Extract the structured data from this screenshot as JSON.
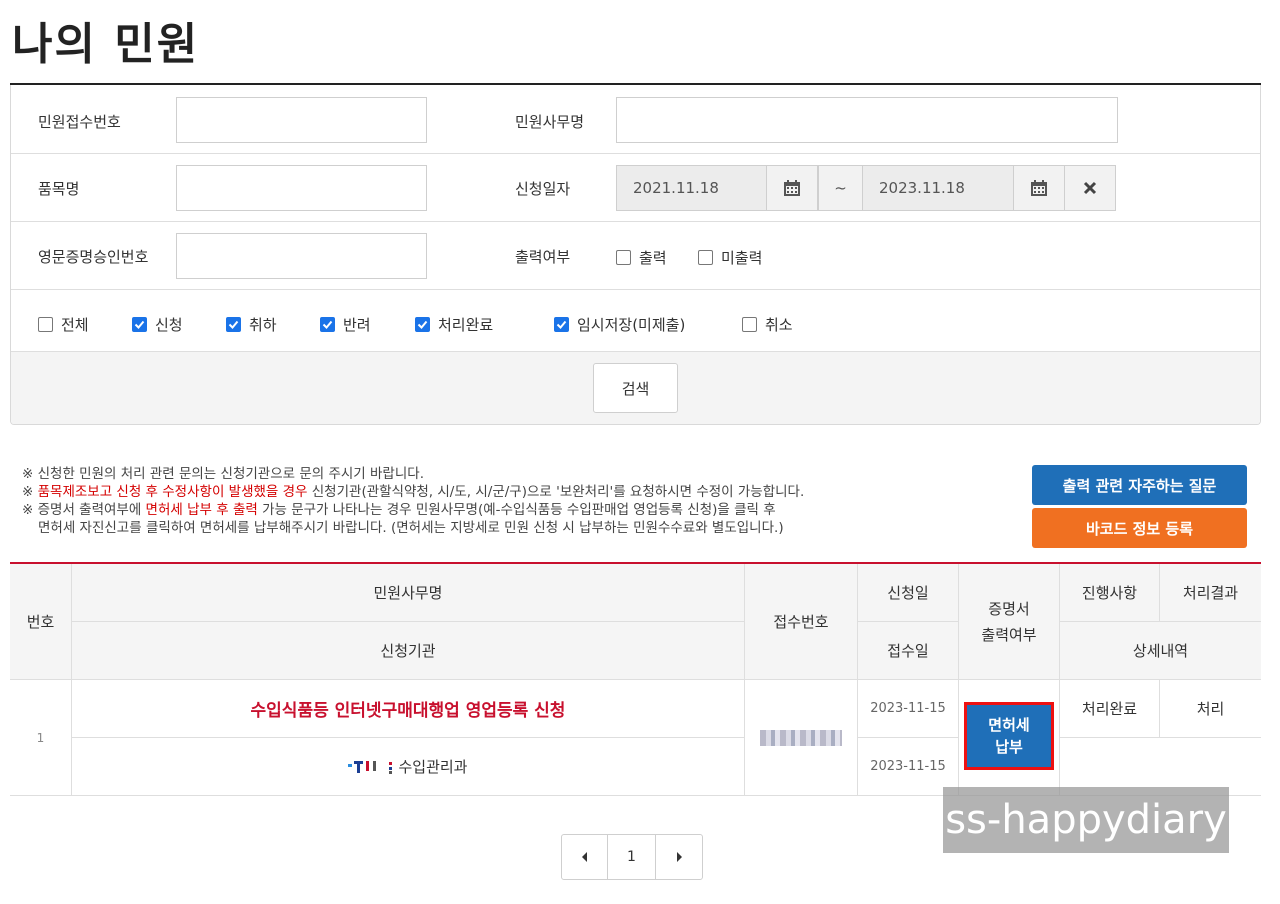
{
  "page": {
    "title": "나의 민원"
  },
  "search": {
    "receipt_no_label": "민원접수번호",
    "receipt_no_value": "",
    "task_name_label": "민원사무명",
    "task_name_value": "",
    "item_name_label": "품목명",
    "item_name_value": "",
    "apply_date_label": "신청일자",
    "date_from": "2021.11.18",
    "date_sep": "~",
    "date_to": "2023.11.18",
    "cert_no_label": "영문증명승인번호",
    "cert_no_value": "",
    "print_label": "출력여부",
    "print_options": [
      {
        "label": "출력",
        "checked": false
      },
      {
        "label": "미출력",
        "checked": false
      }
    ],
    "status_options": [
      {
        "label": "전체",
        "checked": false
      },
      {
        "label": "신청",
        "checked": true
      },
      {
        "label": "취하",
        "checked": true
      },
      {
        "label": "반려",
        "checked": true
      },
      {
        "label": "처리완료",
        "checked": true
      },
      {
        "label": "임시저장(미제출)",
        "checked": true
      },
      {
        "label": "취소",
        "checked": false
      }
    ],
    "search_button": "검색"
  },
  "notice": {
    "line1": "※ 신청한 민원의 처리 관련 문의는 신청기관으로 문의 주시기 바랍니다.",
    "line2_prefix": "※ ",
    "line2_red": "품목제조보고 신청 후 수정사항이 발생했을 경우",
    "line2_rest": " 신청기관(관할식약청, 시/도, 시/군/구)으로 '보완처리'를 요청하시면 수정이 가능합니다.",
    "line3_prefix": "※ 증명서 출력여부에 ",
    "line3_red": "면허세 납부 후 출력",
    "line3_rest": " 가능 문구가 나타나는 경우 민원사무명(예-수입식품등 수입판매업 영업등록 신청)을 클릭 후",
    "line4": "면허세 자진신고를 클릭하여 면허세를 납부해주시기 바랍니다. (면허세는 지방세로 민원 신청 시 납부하는 민원수수료와 별도입니다.)",
    "faq_button": "출력 관련 자주하는 질문",
    "barcode_button": "바코드 정보 등록"
  },
  "table": {
    "headers": {
      "no": "번호",
      "task_name": "민원사무명",
      "agency": "신청기관",
      "receipt_no": "접수번호",
      "apply_date": "신청일",
      "receipt_date": "접수일",
      "cert_print": "증명서\n출력여부",
      "progress": "진행사항",
      "result": "처리결과",
      "detail": "상세내역"
    },
    "rows": [
      {
        "no": "1",
        "task_name": "수입식품등 인터넷구매대행업 영업등록 신청",
        "agency": "수입관리과",
        "apply_date": "2023-11-15",
        "receipt_date": "2023-11-15",
        "cert_button": "면허세\n납부",
        "progress": "처리완료",
        "result": "처리"
      }
    ]
  },
  "pagination": {
    "current": "1",
    "prev_icon": "caret-left-icon",
    "next_icon": "caret-right-icon"
  },
  "watermark": "ss-happydiary",
  "colors": {
    "accent_red": "#c8102e",
    "blue": "#1f6fb8",
    "orange": "#f07021",
    "check_blue": "#1a73e8"
  }
}
